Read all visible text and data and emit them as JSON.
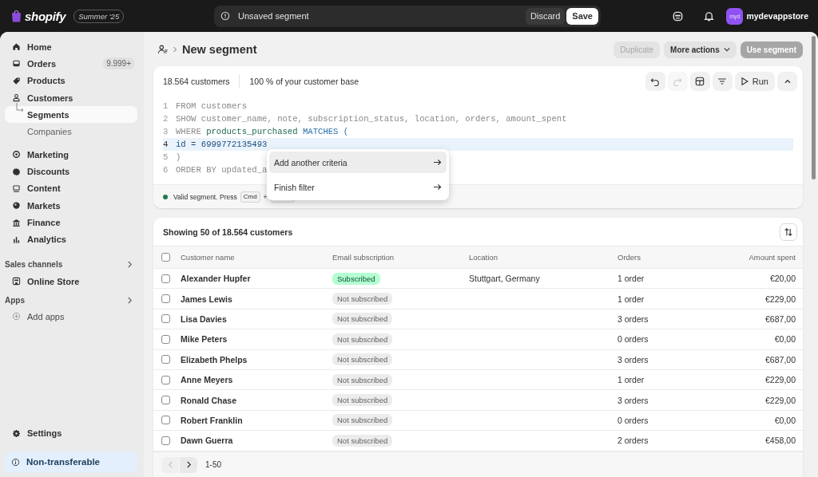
{
  "topbar": {
    "brand": "shopify",
    "edition": "Summer '25",
    "notice": "Unsaved segment",
    "discard": "Discard",
    "save": "Save",
    "avatar": "myd",
    "store": "mydevappstore"
  },
  "sidebar": {
    "groups": [
      [
        {
          "label": "Home",
          "selected": false
        },
        {
          "label": "Orders",
          "badge": "9.999+",
          "selected": false
        },
        {
          "label": "Products",
          "selected": false
        },
        {
          "label": "Customers",
          "selected": false,
          "children": [
            {
              "label": "Segments",
              "selected": true
            },
            {
              "label": "Companies",
              "selected": false
            }
          ]
        }
      ],
      [
        {
          "label": "Marketing",
          "selected": false
        },
        {
          "label": "Discounts",
          "selected": false
        },
        {
          "label": "Content",
          "selected": false
        },
        {
          "label": "Markets",
          "selected": false
        },
        {
          "label": "Finance",
          "selected": false
        },
        {
          "label": "Analytics",
          "selected": false
        }
      ]
    ],
    "sections": [
      {
        "title": "Sales channels",
        "items": [
          {
            "label": "Online Store",
            "kind": "store"
          }
        ]
      },
      {
        "title": "Apps",
        "items": [
          {
            "label": "Add apps",
            "kind": "add"
          }
        ]
      }
    ],
    "settings": "Settings",
    "plan_notice": "Non-transferable"
  },
  "page": {
    "title": "New segment",
    "actions": [
      {
        "label": "Duplicate",
        "disabled": true,
        "kind": "plain"
      },
      {
        "label": "More actions",
        "disabled": false,
        "kind": "menu"
      },
      {
        "label": "Use segment",
        "disabled": true,
        "kind": "primary"
      }
    ]
  },
  "editor": {
    "count": "18.564",
    "count_label": "customers",
    "share": "100",
    "share_label": "% of your customer base",
    "run": "Run",
    "redo_disabled": true,
    "lines": [
      {
        "number": "1",
        "selected": false,
        "tokens": [
          {
            "text": "FROM customers",
            "kind": "keyword"
          }
        ]
      },
      {
        "number": "2",
        "selected": false,
        "tokens": [
          {
            "text": "SHOW customer_name, note, subscription_status, location, orders, amount_spent",
            "kind": "keyword"
          }
        ]
      },
      {
        "number": "3",
        "selected": false,
        "tokens": [
          {
            "text": "WHERE ",
            "kind": "keyword"
          },
          {
            "text": "products_purchased",
            "kind": "field"
          },
          {
            "text": " MATCHES (",
            "kind": "operator"
          }
        ]
      },
      {
        "number": "4",
        "selected": true,
        "tokens": [
          {
            "text": "id = 6999772135493",
            "kind": "value"
          }
        ]
      },
      {
        "number": "5",
        "selected": false,
        "tokens": [
          {
            "text": ")",
            "kind": "keyword"
          }
        ]
      },
      {
        "number": "6",
        "selected": false,
        "tokens": [
          {
            "text": "ORDER BY updated_a",
            "kind": "keyword"
          }
        ]
      }
    ],
    "status": {
      "valid": true,
      "text": "Valid segment. Press",
      "key": "Cmd",
      "plus": "+"
    },
    "menu": [
      {
        "label": "Add another criteria",
        "selected": true
      },
      {
        "label": "Finish filter",
        "selected": false
      }
    ]
  },
  "table": {
    "summary": "Showing 50 of 18.564 customers",
    "all_checked": false,
    "columns": [
      "Customer name",
      "Email subscription",
      "Location",
      "Orders",
      "Amount spent"
    ],
    "rows": [
      {
        "name": "Alexander Hupfer",
        "subscription": "Subscribed",
        "subscribed": true,
        "location": "Stuttgart, Germany",
        "orders": "1 order",
        "amount": "€20,00",
        "checked": false
      },
      {
        "name": "James Lewis",
        "subscription": "Not subscribed",
        "subscribed": false,
        "orders": "1 order",
        "amount": "€229,00",
        "checked": false
      },
      {
        "name": "Lisa Davies",
        "subscription": "Not subscribed",
        "subscribed": false,
        "orders": "3 orders",
        "amount": "€687,00",
        "checked": false
      },
      {
        "name": "Mike Peters",
        "subscription": "Not subscribed",
        "subscribed": false,
        "orders": "0 orders",
        "amount": "€0,00",
        "checked": false
      },
      {
        "name": "Elizabeth Phelps",
        "subscription": "Not subscribed",
        "subscribed": false,
        "orders": "3 orders",
        "amount": "€687,00",
        "checked": false
      },
      {
        "name": "Anne Meyers",
        "subscription": "Not subscribed",
        "subscribed": false,
        "orders": "1 order",
        "amount": "€229,00",
        "checked": false
      },
      {
        "name": "Ronald Chase",
        "subscription": "Not subscribed",
        "subscribed": false,
        "orders": "3 orders",
        "amount": "€229,00",
        "checked": false
      },
      {
        "name": "Robert Franklin",
        "subscription": "Not subscribed",
        "subscribed": false,
        "orders": "0 orders",
        "amount": "€0,00",
        "checked": false
      },
      {
        "name": "Dawn Guerra",
        "subscription": "Not subscribed",
        "subscribed": false,
        "orders": "2 orders",
        "amount": "€458,00",
        "checked": false
      }
    ],
    "range": "1-50",
    "prev_disabled": true
  }
}
